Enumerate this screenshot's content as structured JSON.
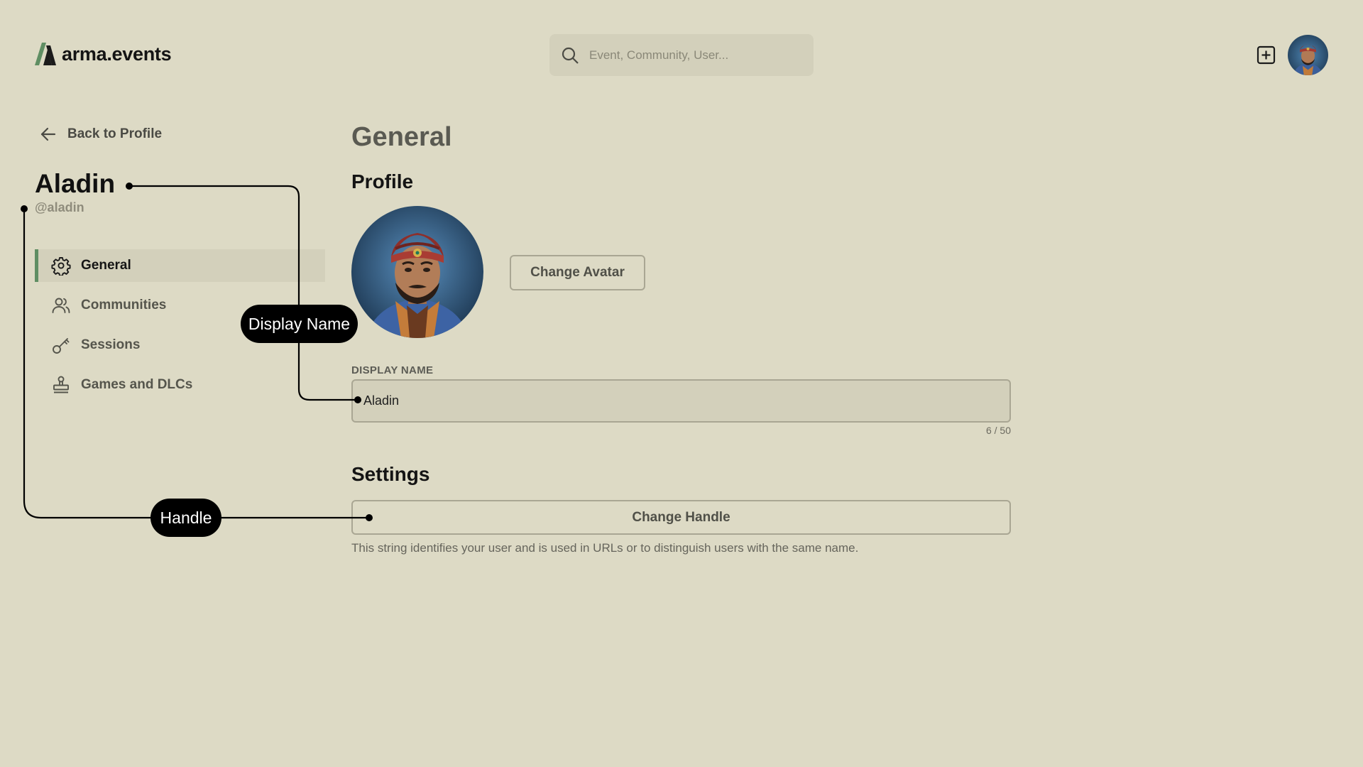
{
  "header": {
    "logo_text": "arma.events",
    "search_placeholder": "Event, Community, User...",
    "icons": [
      "logo-mark",
      "search-icon",
      "plus-square-icon",
      "user-avatar"
    ]
  },
  "sidebar": {
    "back_label": "Back to Profile",
    "user_name": "Aladin",
    "user_handle": "@aladin",
    "items": [
      {
        "label": "General",
        "icon": "gear-icon",
        "active": true
      },
      {
        "label": "Communities",
        "icon": "users-icon",
        "active": false
      },
      {
        "label": "Sessions",
        "icon": "key-icon",
        "active": false
      },
      {
        "label": "Games and DLCs",
        "icon": "stamp-icon",
        "active": false
      }
    ]
  },
  "main": {
    "title": "General",
    "profile_heading": "Profile",
    "change_avatar_label": "Change Avatar",
    "display_name_label": "DISPLAY NAME",
    "display_name_value": "Aladin",
    "char_counter": "6 / 50",
    "settings_heading": "Settings",
    "change_handle_label": "Change Handle",
    "handle_help": "This string identifies your user and is used in URLs or to distinguish users with the same name."
  },
  "annotations": {
    "display_name_pill": "Display Name",
    "handle_pill": "Handle"
  },
  "colors": {
    "background": "#dddac5",
    "panel": "#d3d0bb",
    "accent_green": "#5f8e63",
    "border": "#a9a693"
  }
}
